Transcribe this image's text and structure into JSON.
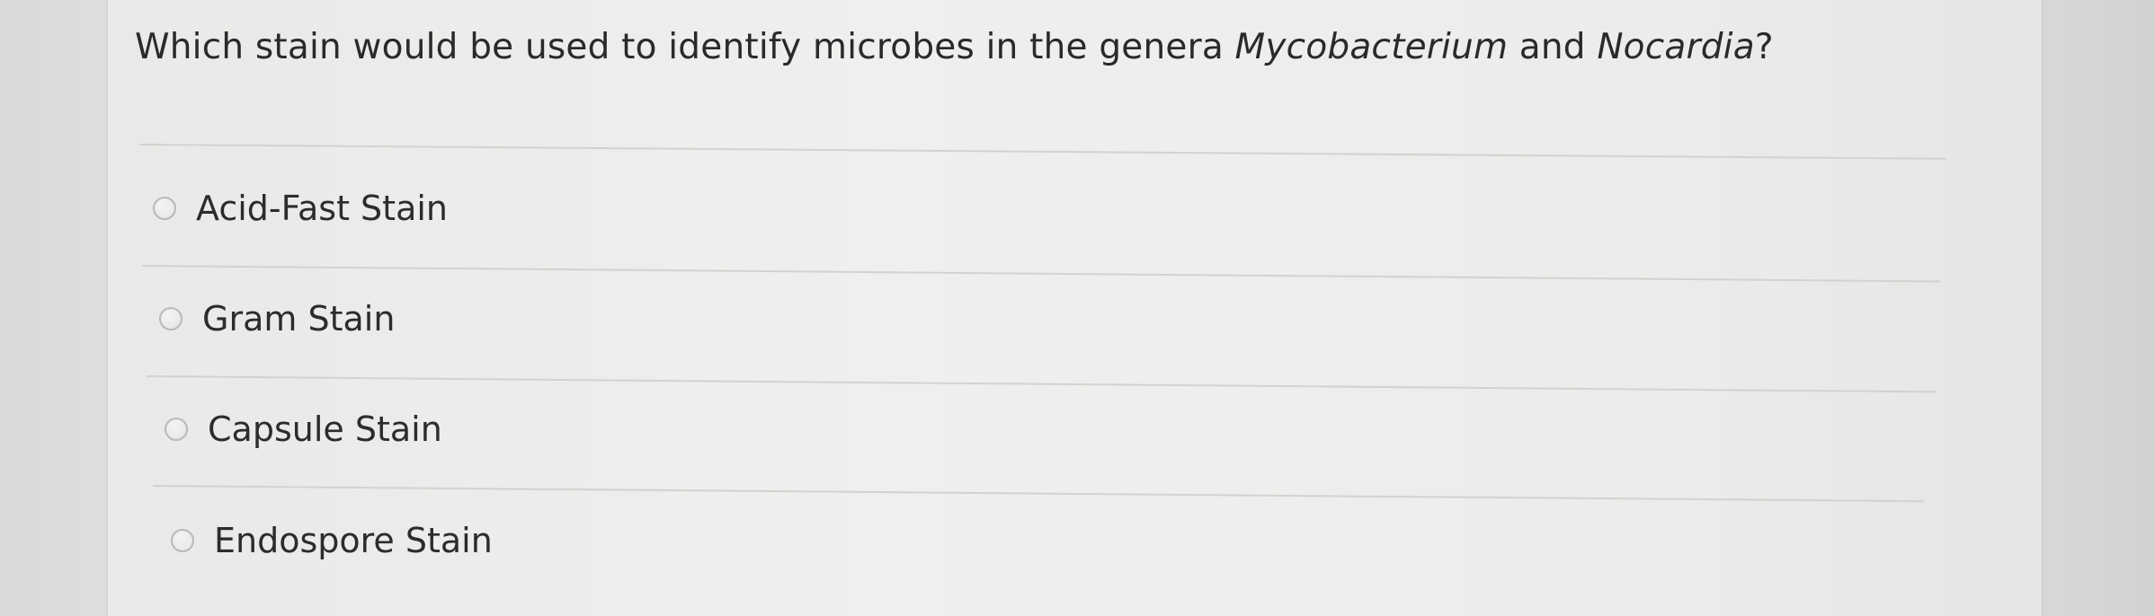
{
  "question": {
    "prefix": "Which stain would be used to identify microbes in the genera ",
    "genus_1": "Mycobacterium",
    "conjunction": " and ",
    "genus_2": "Nocardia",
    "suffix": "?"
  },
  "options": [
    {
      "label": "Acid-Fast Stain",
      "selected": false
    },
    {
      "label": "Gram Stain",
      "selected": false
    },
    {
      "label": "Capsule Stain",
      "selected": false
    },
    {
      "label": "Endospore Stain",
      "selected": false
    }
  ],
  "colors": {
    "background": "#e9e9e7",
    "divider": "#d2d2d0",
    "text": "#2b2b2b",
    "radio_border": "#b9b9b7"
  }
}
